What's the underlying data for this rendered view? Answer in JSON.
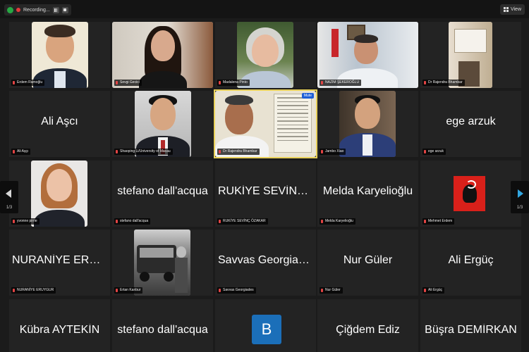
{
  "toolbar": {
    "recording_label": "Recording...",
    "view_label": "View"
  },
  "pager": {
    "left_label": "1/3",
    "right_label": "1/3"
  },
  "mute_badge": "Mute",
  "tiles": [
    {
      "name": "Erdem Ramoğlu"
    },
    {
      "name": "Sevgi Gecici"
    },
    {
      "name": "Madalena Pinto"
    },
    {
      "name": "NAZIM ŞEKEROĞLU"
    },
    {
      "name": "Dr Rajendra Bhambar"
    },
    {
      "name": "Ali Aşçı",
      "display": "Ali Aşcı"
    },
    {
      "name": "Shaoping Li/University of Macau"
    },
    {
      "name": "Dr Rajendra Bhambar"
    },
    {
      "name": "Jambo Xiao"
    },
    {
      "name": "ege arzuk",
      "display": "ege arzuk"
    },
    {
      "name": "yvonne pirrie"
    },
    {
      "name": "stefano dall'acqua",
      "display": "stefano dall'acqua"
    },
    {
      "name": "RUKİYE SEVİNÇ ÖZAKAR",
      "display": "RUKİYE SEVİNÇ Ö..."
    },
    {
      "name": "Melda Karyelioğlu",
      "display": "Melda Karyelioğlu"
    },
    {
      "name": "Mehmet Erdem"
    },
    {
      "name": "NURANİYE ERUYGUR",
      "display": "NURANİYE ERUY..."
    },
    {
      "name": "Ertan Kanbur"
    },
    {
      "name": "Savvas Georgiades",
      "display": "Savvas Georgiades"
    },
    {
      "name": "Nur Güler",
      "display": "Nur Güler"
    },
    {
      "name": "Ali Ergüç",
      "display": "Ali Ergüç"
    },
    {
      "name": "",
      "display": "Kübra AYTEKİN"
    },
    {
      "name": "",
      "display": "stefano dall'acqua"
    },
    {
      "name": "",
      "avatar": "B"
    },
    {
      "name": "",
      "display": "Çiğdem Ediz"
    },
    {
      "name": "",
      "display": "Büşra DEMİRKAN"
    }
  ]
}
